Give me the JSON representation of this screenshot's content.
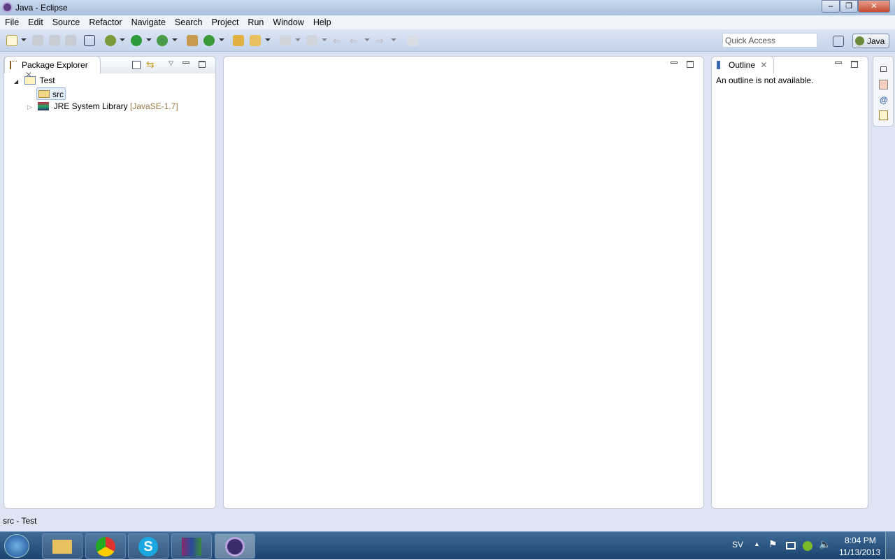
{
  "window": {
    "title": "Java - Eclipse"
  },
  "menu": [
    "File",
    "Edit",
    "Source",
    "Refactor",
    "Navigate",
    "Search",
    "Project",
    "Run",
    "Window",
    "Help"
  ],
  "toolbar": {
    "quick_access_placeholder": "Quick Access",
    "perspective": "Java"
  },
  "package_explorer": {
    "title": "Package Explorer",
    "tree": {
      "project": "Test",
      "src": "src",
      "jre": "JRE System Library",
      "jre_version": "[JavaSE-1.7]"
    }
  },
  "outline": {
    "title": "Outline",
    "message": "An outline is not available."
  },
  "status": {
    "text": "src - Test"
  },
  "taskbar": {
    "lang": "SV",
    "time": "8:04 PM",
    "date": "11/13/2013"
  },
  "colors": {
    "accent": "#3d6a96",
    "decoration": "#9a7a4a"
  }
}
